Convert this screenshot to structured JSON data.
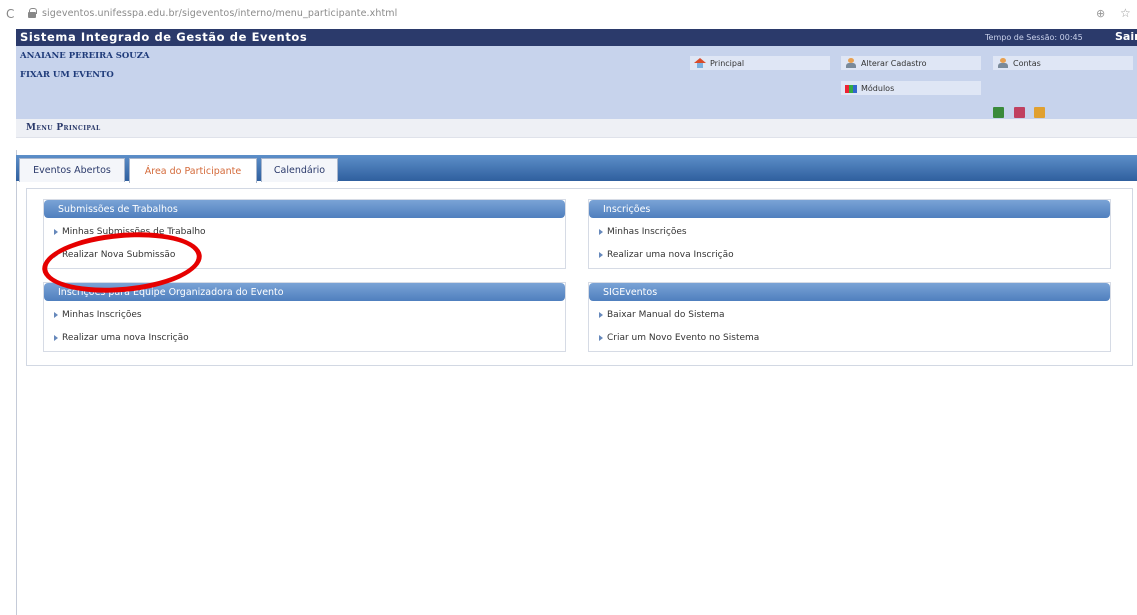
{
  "browser": {
    "url": "sigeventos.unifesspa.edu.br/sigeventos/interno/menu_participante.xhtml",
    "zoom_glyph": "⊕",
    "star_glyph": "☆",
    "reload_glyph": "C"
  },
  "header": {
    "title": "Sistema Integrado de Gestão de Eventos",
    "session": "Tempo de Sessão: 00:45",
    "logout": "Sair"
  },
  "user": {
    "name": "ANAIANE PEREIRA SOUZA",
    "action": "FIXAR UM EVENTO"
  },
  "top_buttons": {
    "principal": "Principal",
    "alterar_cadastro": "Alterar Cadastro",
    "contas": "Contas",
    "modulos": "Módulos"
  },
  "menu": {
    "title": "Menu Principal"
  },
  "tabs": [
    {
      "label": "Eventos Abertos"
    },
    {
      "label": "Área do Participante"
    },
    {
      "label": "Calendário"
    }
  ],
  "boxes": {
    "submissoes": {
      "title": "Submissões de Trabalhos",
      "links": [
        "Minhas Submissões de Trabalho",
        "Realizar Nova Submissão"
      ]
    },
    "inscricoes": {
      "title": "Inscrições",
      "links": [
        "Minhas Inscrições",
        "Realizar uma nova Inscrição"
      ]
    },
    "equipe": {
      "title": "Inscrições para Equipe Organizadora do Evento",
      "links": [
        "Minhas Inscrições",
        "Realizar uma nova Inscrição"
      ]
    },
    "sigeventos": {
      "title": "SIGEventos",
      "links": [
        "Baixar Manual do Sistema",
        "Criar um Novo Evento no Sistema"
      ]
    }
  },
  "colors": {
    "header_bg": "#2b3a6b",
    "info_bg": "#c7d3ec",
    "tab_strip": "#3f6fae",
    "active_tab_text": "#d46a3a",
    "annotation_red": "#e60000"
  }
}
